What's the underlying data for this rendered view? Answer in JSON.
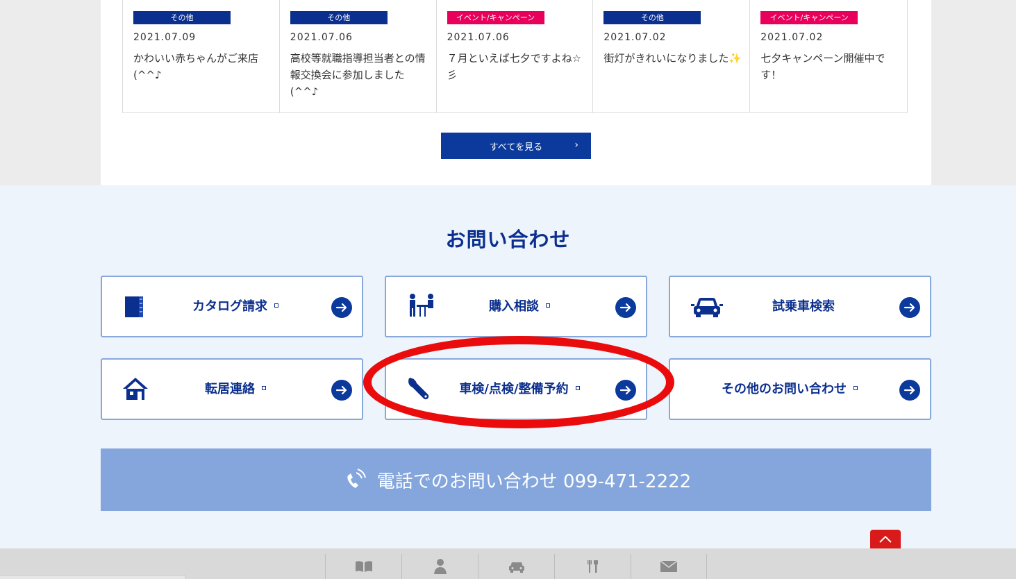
{
  "news": [
    {
      "tag": "その他",
      "tag_color": "#0b2f8e",
      "date": "2021.07.09",
      "title": "かわいい赤ちゃんがご来店(^^♪"
    },
    {
      "tag": "その他",
      "tag_color": "#0b2f8e",
      "date": "2021.07.06",
      "title": "高校等就職指導担当者との情報交換会に参加しました(^^♪"
    },
    {
      "tag": "イベント/キャンペーン",
      "tag_color": "#e8005a",
      "date": "2021.07.06",
      "title": "７月といえば七夕ですよね☆彡"
    },
    {
      "tag": "その他",
      "tag_color": "#0b2f8e",
      "date": "2021.07.02",
      "title": "街灯がきれいになりました✨"
    },
    {
      "tag": "イベント/キャンペーン",
      "tag_color": "#e8005a",
      "date": "2021.07.02",
      "title": "七夕キャンペーン開催中です！"
    }
  ],
  "see_all_label": "すべてを見る",
  "contact": {
    "title": "お問い合わせ",
    "buttons": [
      {
        "label": "カタログ請求",
        "icon": "catalog-book-icon"
      },
      {
        "label": "購入相談",
        "icon": "consultation-people-icon"
      },
      {
        "label": "試乗車検索",
        "icon": "car-icon"
      },
      {
        "label": "転居連絡",
        "icon": "house-icon"
      },
      {
        "label": "車検/点検/整備予約",
        "icon": "wrench-icon"
      },
      {
        "label": "その他のお問い合わせ",
        "icon": ""
      }
    ],
    "phone_text": "電話でのお問い合わせ 099-471-2222"
  },
  "bottom_nav": [
    "book-icon",
    "person-icon",
    "car-icon",
    "tools-icon",
    "mail-icon"
  ],
  "colors": {
    "brand": "#0b2f8e",
    "pink": "#e8005a",
    "highlight": "#ea0c0c"
  }
}
